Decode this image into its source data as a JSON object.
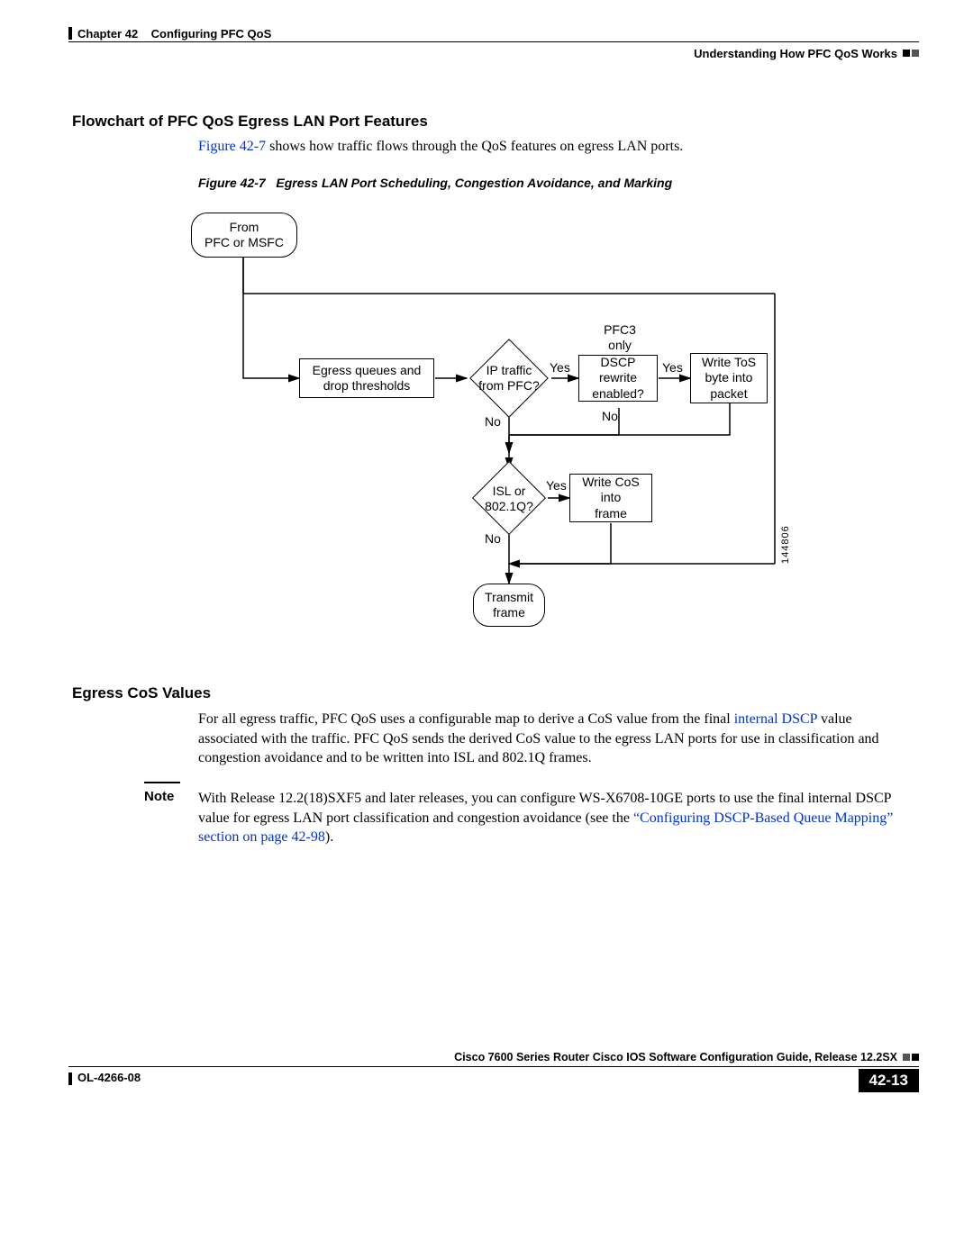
{
  "header": {
    "chapter_label": "Chapter 42",
    "chapter_title": "Configuring PFC QoS",
    "section_right": "Understanding How PFC QoS Works"
  },
  "section1": {
    "heading": "Flowchart of PFC QoS Egress LAN Port Features",
    "fig_ref": "Figure 42-7",
    "intro_rest": " shows how traffic flows through the QoS features on egress LAN ports.",
    "fig_caption_label": "Figure 42-7",
    "fig_caption_title": "Egress LAN Port Scheduling, Congestion Avoidance, and Marking"
  },
  "diagram": {
    "start": "From\nPFC or MSFC",
    "egress_box": "Egress queues and\ndrop thresholds",
    "d1": "IP traffic\nfrom PFC?",
    "pfc3": "PFC3\nonly",
    "d2": "DSCP\nrewrite\nenabled?",
    "tos_box": "Write ToS\nbyte into\npacket",
    "d3": "ISL or\n802.1Q?",
    "cos_box": "Write CoS\ninto\nframe",
    "end": "Transmit\nframe",
    "yes": "Yes",
    "no": "No",
    "imgnum": "144806"
  },
  "section2": {
    "heading": "Egress CoS Values",
    "p_lead": "For all egress traffic, PFC QoS uses a configurable map to derive a CoS value from the final ",
    "link1": "internal DSCP",
    "p_rest": " value associated with the traffic. PFC QoS sends the derived CoS value to the egress LAN ports for use in classification and congestion avoidance and to be written into ISL and 802.1Q frames."
  },
  "note": {
    "label": "Note",
    "text1": "With Release 12.2(18)SXF5 and later releases, you can configure WS-X6708-10GE ports to use the final internal DSCP value for egress LAN port classification and congestion avoidance (see the ",
    "link": "“Configuring DSCP-Based Queue Mapping” section on page 42-98",
    "text2": ")."
  },
  "footer": {
    "book": "Cisco 7600 Series Router Cisco IOS Software Configuration Guide, Release 12.2SX",
    "doc": "OL-4266-08",
    "page": "42-13"
  }
}
